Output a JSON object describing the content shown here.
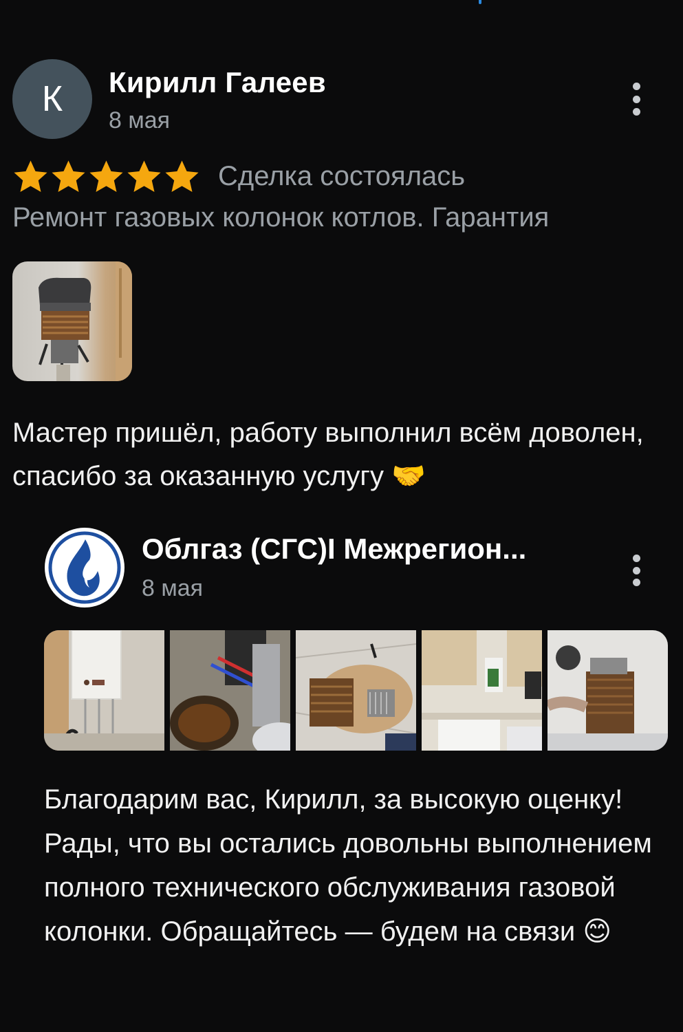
{
  "review": {
    "avatar_letter": "К",
    "author": "Кирилл Галеев",
    "date": "8 мая",
    "rating": 5,
    "deal_status": "Сделка состоялась",
    "service": "Ремонт газовых колонок котлов. Гарантия",
    "text": "Мастер пришёл, работу выполнил всём доволен, спасибо за оказанную услугу 🤝",
    "photos": [
      "gas-heater-repair-photo"
    ]
  },
  "reply": {
    "author": "Облгаз (СГС)I Межрегион...",
    "date": "8 мая",
    "photos": [
      "gas-water-heater-on-wall-photo",
      "heat-exchanger-detail-photo",
      "disassembled-heater-photo",
      "kitchen-with-heater-photo",
      "heat-exchanger-cleaning-photo"
    ],
    "text": "Благодарим вас, Кирилл, за высокую оценку! Рады, что вы остались довольны выполнением полного технического обслуживания газовой колонки. Обращайтесь — будем на связи 😊"
  },
  "colors": {
    "background": "#0b0b0c",
    "star": "#f5a70f",
    "muted_text": "#9aa0a6",
    "avatar_bg": "#44525c",
    "brand_blue": "#1e4fa0",
    "top_indicator": "#2a8ae0"
  }
}
